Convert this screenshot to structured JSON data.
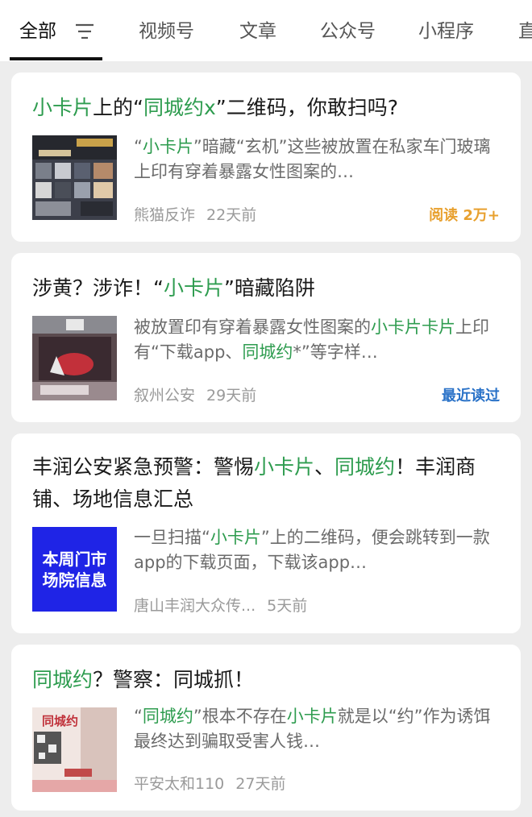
{
  "tabs": {
    "active": "全部",
    "items": [
      "视频号",
      "文章",
      "公众号",
      "小程序",
      "直"
    ]
  },
  "colors": {
    "highlight": "#2e9c4f",
    "read_badge": "#e8a02e",
    "recent_badge": "#2b73c8"
  },
  "results": [
    {
      "title_parts": [
        {
          "t": "小卡片",
          "h": true
        },
        {
          "t": "上的“",
          "h": false
        },
        {
          "t": "同城约x",
          "h": true
        },
        {
          "t": "”二维码，你敢扫吗?",
          "h": false
        }
      ],
      "snippet_parts": [
        {
          "t": "“",
          "h": false
        },
        {
          "t": "小卡片",
          "h": true
        },
        {
          "t": "”暗藏“玄机”这些被放置在私家车门玻璃上印有穿着暴露女性图案的…",
          "h": false
        }
      ],
      "source": "熊猫反诈",
      "time": "22天前",
      "badge": "阅读 2万+"
    },
    {
      "title_parts": [
        {
          "t": "涉黄？涉诈！“",
          "h": false
        },
        {
          "t": "小卡片",
          "h": true
        },
        {
          "t": "”暗藏陷阱",
          "h": false
        }
      ],
      "snippet_parts": [
        {
          "t": "被放置印有穿着暴露女性图案的",
          "h": false
        },
        {
          "t": "小卡片卡片",
          "h": true
        },
        {
          "t": "上印有“下载app、",
          "h": false
        },
        {
          "t": "同城约",
          "h": true
        },
        {
          "t": "*”等字样…",
          "h": false
        }
      ],
      "source": "叙州公安",
      "time": "29天前",
      "badge": "最近读过"
    },
    {
      "title_parts": [
        {
          "t": "丰润公安紧急预警：警惕",
          "h": false
        },
        {
          "t": "小卡片",
          "h": true
        },
        {
          "t": "、",
          "h": false
        },
        {
          "t": "同城约",
          "h": true
        },
        {
          "t": "！丰润商铺、场地信息汇总",
          "h": false
        }
      ],
      "snippet_parts": [
        {
          "t": "一旦扫描“",
          "h": false
        },
        {
          "t": "小卡片",
          "h": true
        },
        {
          "t": "”上的二维码，便会跳转到一款app的下载页面，下载该app…",
          "h": false
        }
      ],
      "thumb_text": "本周门市场院信息",
      "source": "唐山丰润大众传...",
      "time": "5天前",
      "badge": ""
    },
    {
      "title_parts": [
        {
          "t": "同城约",
          "h": true
        },
        {
          "t": "？警察：同城抓！",
          "h": false
        }
      ],
      "snippet_parts": [
        {
          "t": "“",
          "h": false
        },
        {
          "t": "同城约",
          "h": true
        },
        {
          "t": "”根本不存在",
          "h": false
        },
        {
          "t": "小卡片",
          "h": true
        },
        {
          "t": "就是以“约”作为诱饵最终达到骗取受害人钱…",
          "h": false
        }
      ],
      "thumb_text": "同城约",
      "source": "平安太和110",
      "time": "27天前",
      "badge": ""
    }
  ]
}
